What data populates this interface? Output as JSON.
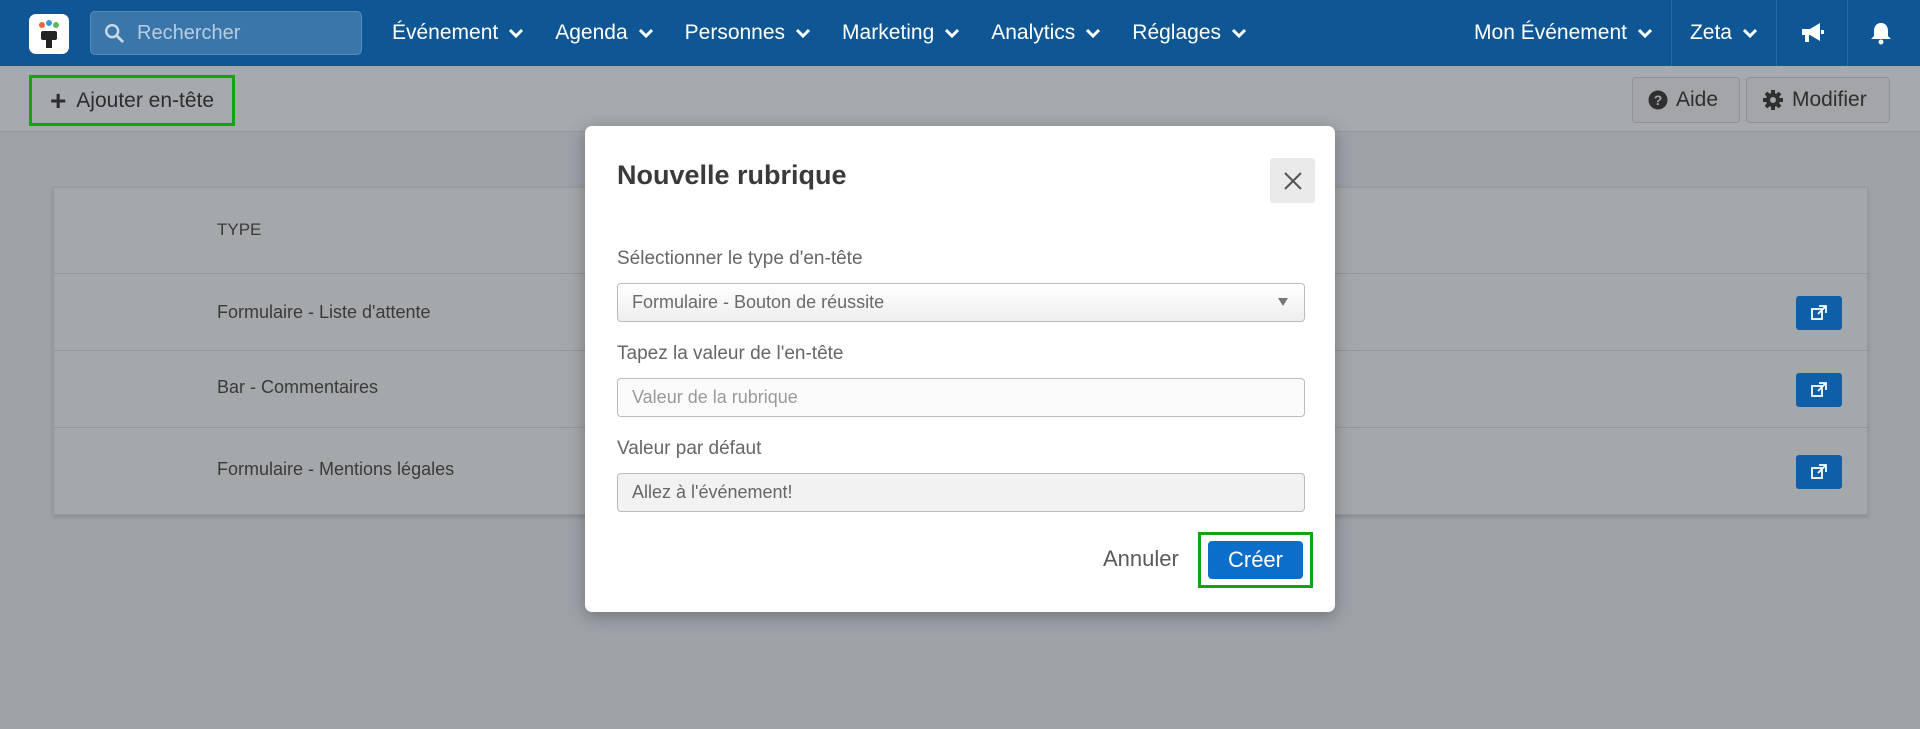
{
  "navbar": {
    "search_placeholder": "Rechercher",
    "menu": [
      {
        "label": "Événement"
      },
      {
        "label": "Agenda"
      },
      {
        "label": "Personnes"
      },
      {
        "label": "Marketing"
      },
      {
        "label": "Analytics"
      },
      {
        "label": "Réglages"
      }
    ],
    "right": {
      "event_label": "Mon Événement",
      "user_label": "Zeta"
    },
    "colors": {
      "bar": "#0e5694"
    }
  },
  "toolbar": {
    "add_label": "Ajouter en-tête",
    "help_label": "Aide",
    "edit_label": "Modifier"
  },
  "table": {
    "header_type": "TYPE",
    "rows": [
      {
        "type": "Formulaire - Liste d'attente"
      },
      {
        "type": "Bar - Commentaires"
      },
      {
        "type": "Formulaire - Mentions légales"
      }
    ]
  },
  "modal": {
    "title": "Nouvelle rubrique",
    "select_label": "Sélectionner le type d'en-tête",
    "select_value": "Formulaire - Bouton de réussite",
    "value_label": "Tapez la valeur de l'en-tête",
    "value_placeholder": "Valeur de la rubrique",
    "default_label": "Valeur par défaut",
    "default_value": "Allez à l'événement!",
    "cancel_label": "Annuler",
    "create_label": "Créer",
    "accent_color": "#0c6ecb"
  }
}
